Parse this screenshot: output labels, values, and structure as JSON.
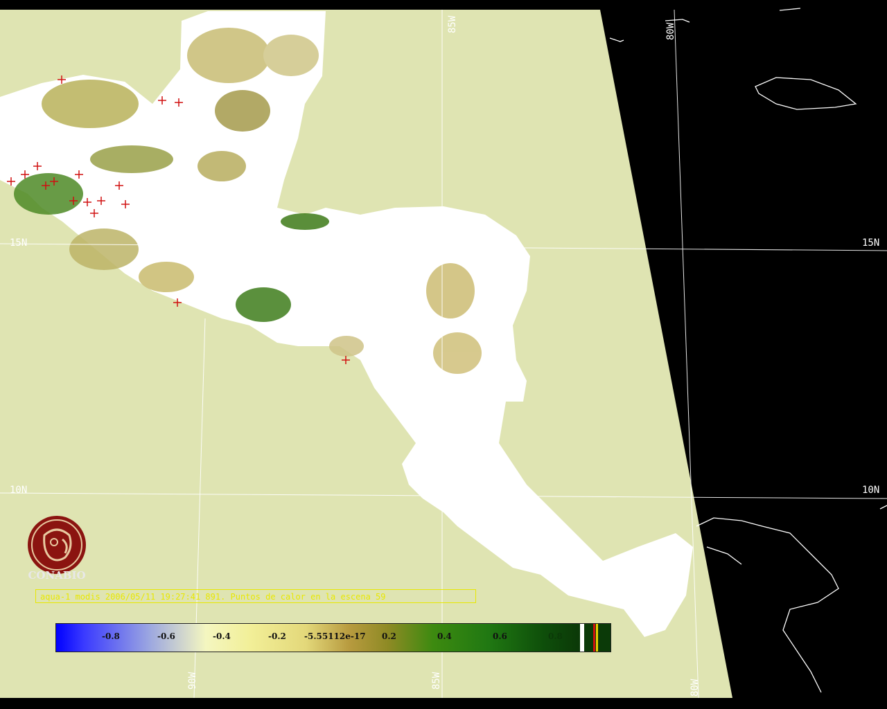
{
  "map": {
    "grid_labels": {
      "lat_15_left": "15N",
      "lat_15_right": "15N",
      "lat_10_left": "10N",
      "lat_10_right": "10N",
      "lon_85_top": "85W",
      "lon_80_top": "80W",
      "lon_90_bottom": "90W",
      "lon_85_bottom": "85W",
      "lon_80_bottom": "80W"
    },
    "colors": {
      "background": "#000000",
      "sea_within_swath": "#dfe4b2",
      "cloud_mask": "#ffffff",
      "fire_marker": "#d01010",
      "coastline": "#ffffff",
      "caption_text": "#e8e800"
    }
  },
  "logo": {
    "name": "CONABIO"
  },
  "caption": "aqua-1 modis 2006/05/11 19:27:41 891. Puntos de calor en la escena 59",
  "colorbar": {
    "ticks": [
      "-0.8",
      "-0.6",
      "-0.4",
      "-0.2",
      "-5.55112e-17",
      "0.2",
      "0.4",
      "0.6",
      "0.8"
    ]
  }
}
